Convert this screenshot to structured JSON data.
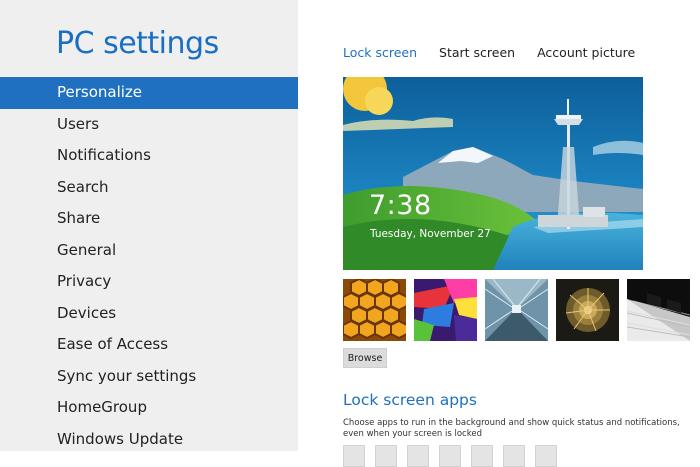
{
  "sidebar": {
    "title": "PC settings",
    "items": [
      {
        "label": "Personalize"
      },
      {
        "label": "Users"
      },
      {
        "label": "Notifications"
      },
      {
        "label": "Search"
      },
      {
        "label": "Share"
      },
      {
        "label": "General"
      },
      {
        "label": "Privacy"
      },
      {
        "label": "Devices"
      },
      {
        "label": "Ease of Access"
      },
      {
        "label": "Sync your settings"
      },
      {
        "label": "HomeGroup"
      },
      {
        "label": "Windows Update"
      }
    ],
    "selected_index": 0
  },
  "tabs": [
    {
      "label": "Lock screen",
      "active": true
    },
    {
      "label": "Start screen",
      "active": false
    },
    {
      "label": "Account picture",
      "active": false
    }
  ],
  "preview": {
    "time": "7:38",
    "date": "Tuesday, November 27"
  },
  "thumbnails": [
    {
      "name": "honeycomb"
    },
    {
      "name": "colorful-shapes"
    },
    {
      "name": "tunnel"
    },
    {
      "name": "nautilus-shell"
    },
    {
      "name": "piano-keys"
    }
  ],
  "browse_label": "Browse",
  "lock_apps": {
    "title": "Lock screen apps",
    "description": "Choose apps to run in the background and show quick status and notifications, even when your screen is locked",
    "slot_count": 7
  },
  "colors": {
    "accent": "#1f70c1",
    "sidebar_bg": "#efefef"
  }
}
